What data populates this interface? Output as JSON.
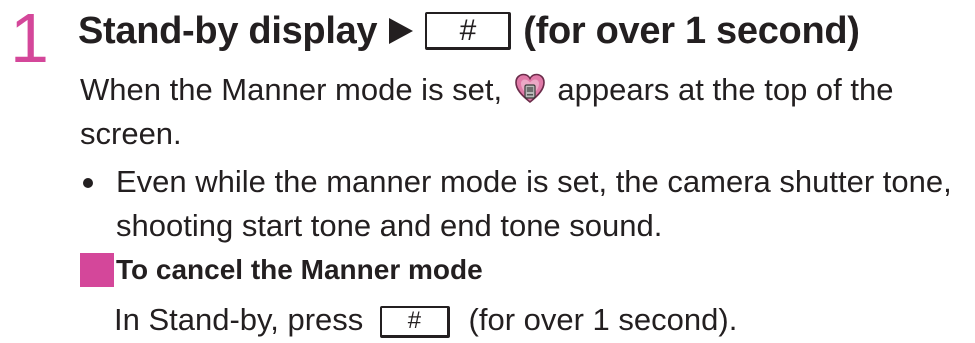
{
  "colors": {
    "accent": "#d4479a",
    "text": "#231f20"
  },
  "step": {
    "number": "1",
    "heading_start": "Stand-by display",
    "key_label": "#",
    "heading_end": "(for over 1 second)"
  },
  "paragraph1": {
    "before_icon": "When the Manner mode is set,",
    "icon": "manner-mode-heart-icon",
    "after_icon": "appears at the top of the screen."
  },
  "bullet": {
    "text": "Even while the manner mode is set, the camera shutter tone, shooting start tone and end tone sound."
  },
  "subsection": {
    "heading": "To cancel the Manner mode",
    "text_before": "In Stand-by, press",
    "key_label": "#",
    "text_after": "(for over 1 second)."
  }
}
